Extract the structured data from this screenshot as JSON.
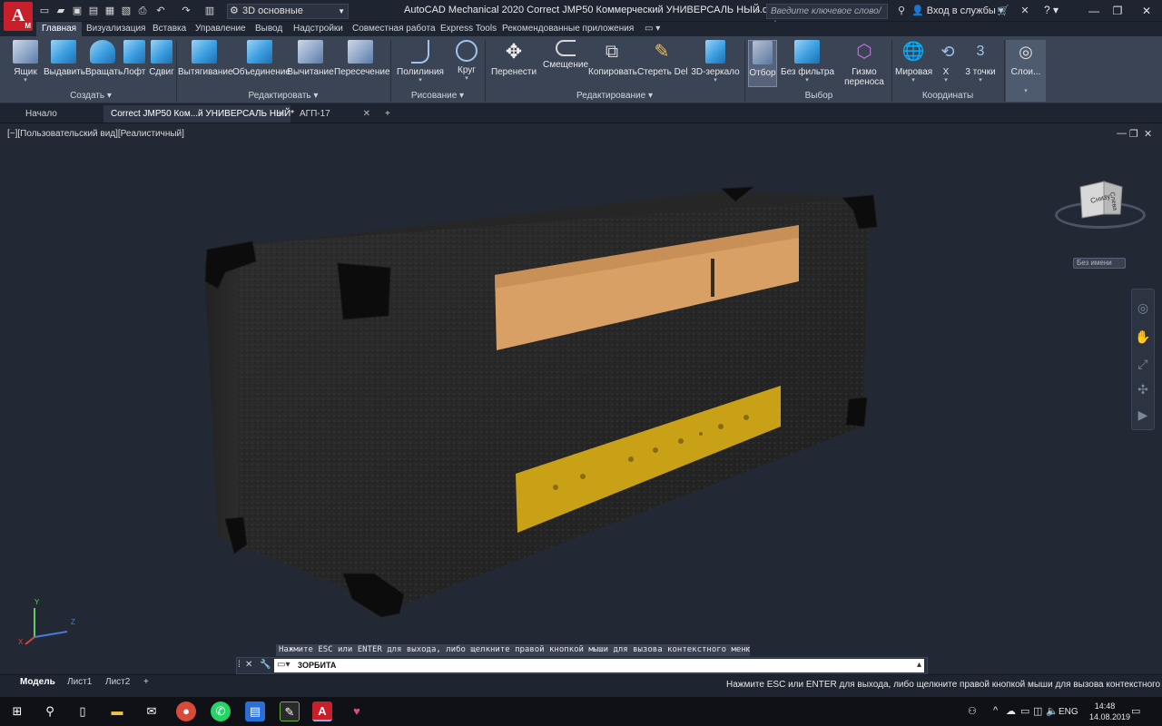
{
  "app": {
    "logo_letter": "A",
    "logo_sub": "M",
    "workspace": "3D основные",
    "title": "AutoCAD Mechanical 2020   Correct JMP50 Коммерческий УНИВЕРСАЛЬ НЫЙ.dwg",
    "search_placeholder": "Введите ключевое слово/фразу",
    "signin": "Вход в службы",
    "help": "?"
  },
  "ribbon_tabs": [
    "Главная",
    "Визуализация",
    "Вставка",
    "Управление",
    "Вывод",
    "Надстройки",
    "Совместная работа",
    "Express Tools",
    "Рекомендованные приложения"
  ],
  "ribbon": {
    "tools": {
      "box": "Ящик",
      "extrude": "Выдавить",
      "revolve": "Вращать",
      "loft": "Лофт",
      "sweep": "Сдвиг",
      "presspull": "Вытягивание",
      "union": "Объединение",
      "subtract": "Вычитание",
      "intersect": "Пересечение",
      "polyline": "Полилиния",
      "circle": "Круг",
      "move": "Перенести",
      "offset": "Смещение",
      "copy": "Копировать",
      "erase": "Стереть Del",
      "mirror3d": "3D-зеркало",
      "culling": "Отбор",
      "nofilter": "Без фильтра",
      "gizmo": "Гизмо переноса",
      "world": "Мировая",
      "x": "X",
      "threepoint": "3 точки",
      "layers": "Слои..."
    },
    "groups": {
      "create": "Создать",
      "edit": "Редактировать",
      "draw": "Рисование",
      "modify": "Редактирование",
      "selection": "Выбор",
      "coordinates": "Координаты"
    }
  },
  "file_tabs": {
    "start": "Начало",
    "doc1": "Correct JMP50 Ком...й УНИВЕРСАЛЬ НЫЙ*",
    "doc2": "АГП-17",
    "close": "✕",
    "add": "+"
  },
  "viewport": {
    "label": "[−][Пользовательский вид][Реалистичный]",
    "viewcube_top": "Снизу",
    "viewcube_side": "Слева",
    "named_view": "Без имени",
    "ucs_x": "X",
    "ucs_y": "Y",
    "ucs_z": "Z"
  },
  "command": {
    "prompt": "Нажмите ESC или ENTER для выхода, либо щелкните правой кнопкой мыши для вызова контекстного меню.",
    "input": "3ОРБИТА"
  },
  "layout_tabs": [
    "Модель",
    "Лист1",
    "Лист2"
  ],
  "status": {
    "message": "Нажмите ESC или ENTER для выхода, либо щелкните правой кнопкой мыши для вызова контекстного меню."
  },
  "taskbar": {
    "language": "ENG",
    "time": "14:48",
    "date": "14.08.2019"
  },
  "colors": {
    "background": "#222935",
    "ribbon": "#3b4455",
    "model_body": "#2a2a2a",
    "grille": "#d9a066",
    "panel": "#c9a116"
  }
}
